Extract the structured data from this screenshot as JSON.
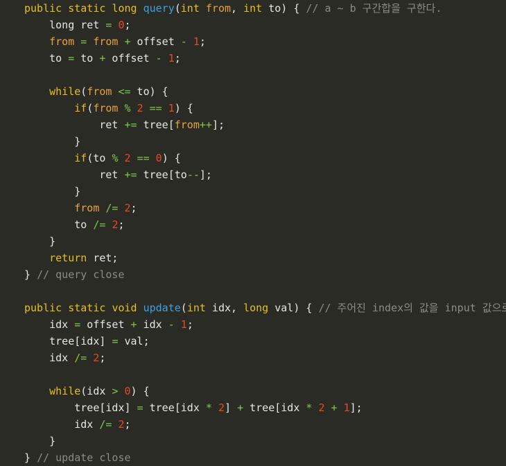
{
  "editor": {
    "name": "java-code-viewer",
    "language": "Java",
    "background_color": "#2b2b26",
    "font_size_px": 15,
    "line_height_px": 24,
    "colors": {
      "background": "#2b2b26",
      "default_text": "#e6e6e6",
      "keyword": "#e5c01e",
      "method": "#3fa2e0",
      "field": "#e8a33d",
      "number": "#e8491f",
      "operator": "#7ec94a",
      "comment": "#8c8c86"
    }
  },
  "code": {
    "lines": [
      {
        "id": 1,
        "indent": 0,
        "tokens": [
          {
            "t": "kw",
            "v": "public"
          },
          {
            "t": "txt",
            "v": " "
          },
          {
            "t": "kw",
            "v": "static"
          },
          {
            "t": "txt",
            "v": " "
          },
          {
            "t": "kw",
            "v": "long"
          },
          {
            "t": "txt",
            "v": " "
          },
          {
            "t": "mth",
            "v": "query"
          },
          {
            "t": "txt",
            "v": "("
          },
          {
            "t": "kw",
            "v": "int"
          },
          {
            "t": "txt",
            "v": " "
          },
          {
            "t": "fld",
            "v": "from"
          },
          {
            "t": "txt",
            "v": ", "
          },
          {
            "t": "kw",
            "v": "int"
          },
          {
            "t": "txt",
            "v": " to) { "
          },
          {
            "t": "cmt",
            "v": "// a ~ b 구간합을 구한다."
          }
        ]
      },
      {
        "id": 2,
        "indent": 1,
        "tokens": [
          {
            "t": "txt",
            "v": "long ret "
          },
          {
            "t": "op",
            "v": "="
          },
          {
            "t": "txt",
            "v": " "
          },
          {
            "t": "num",
            "v": "0"
          },
          {
            "t": "txt",
            "v": ";"
          }
        ]
      },
      {
        "id": 3,
        "indent": 1,
        "tokens": [
          {
            "t": "fld",
            "v": "from"
          },
          {
            "t": "txt",
            "v": " "
          },
          {
            "t": "op",
            "v": "="
          },
          {
            "t": "txt",
            "v": " "
          },
          {
            "t": "fld",
            "v": "from"
          },
          {
            "t": "txt",
            "v": " "
          },
          {
            "t": "op",
            "v": "+"
          },
          {
            "t": "txt",
            "v": " offset "
          },
          {
            "t": "op",
            "v": "-"
          },
          {
            "t": "txt",
            "v": " "
          },
          {
            "t": "num",
            "v": "1"
          },
          {
            "t": "txt",
            "v": ";"
          }
        ]
      },
      {
        "id": 4,
        "indent": 1,
        "tokens": [
          {
            "t": "txt",
            "v": "to "
          },
          {
            "t": "op",
            "v": "="
          },
          {
            "t": "txt",
            "v": " to "
          },
          {
            "t": "op",
            "v": "+"
          },
          {
            "t": "txt",
            "v": " offset "
          },
          {
            "t": "op",
            "v": "-"
          },
          {
            "t": "txt",
            "v": " "
          },
          {
            "t": "num",
            "v": "1"
          },
          {
            "t": "txt",
            "v": ";"
          }
        ]
      },
      {
        "id": 5,
        "indent": 0,
        "tokens": []
      },
      {
        "id": 6,
        "indent": 1,
        "tokens": [
          {
            "t": "kw",
            "v": "while"
          },
          {
            "t": "txt",
            "v": "("
          },
          {
            "t": "fld",
            "v": "from"
          },
          {
            "t": "txt",
            "v": " "
          },
          {
            "t": "op",
            "v": "<="
          },
          {
            "t": "txt",
            "v": " to) {"
          }
        ]
      },
      {
        "id": 7,
        "indent": 2,
        "tokens": [
          {
            "t": "kw",
            "v": "if"
          },
          {
            "t": "txt",
            "v": "("
          },
          {
            "t": "fld",
            "v": "from"
          },
          {
            "t": "txt",
            "v": " "
          },
          {
            "t": "op",
            "v": "%"
          },
          {
            "t": "txt",
            "v": " "
          },
          {
            "t": "num",
            "v": "2"
          },
          {
            "t": "txt",
            "v": " "
          },
          {
            "t": "op",
            "v": "=="
          },
          {
            "t": "txt",
            "v": " "
          },
          {
            "t": "num",
            "v": "1"
          },
          {
            "t": "txt",
            "v": ") {"
          }
        ]
      },
      {
        "id": 8,
        "indent": 3,
        "tokens": [
          {
            "t": "txt",
            "v": "ret "
          },
          {
            "t": "op",
            "v": "+="
          },
          {
            "t": "txt",
            "v": " tree["
          },
          {
            "t": "fld",
            "v": "from"
          },
          {
            "t": "op",
            "v": "++"
          },
          {
            "t": "txt",
            "v": "];"
          }
        ]
      },
      {
        "id": 9,
        "indent": 2,
        "tokens": [
          {
            "t": "txt",
            "v": "}"
          }
        ]
      },
      {
        "id": 10,
        "indent": 2,
        "tokens": [
          {
            "t": "kw",
            "v": "if"
          },
          {
            "t": "txt",
            "v": "(to "
          },
          {
            "t": "op",
            "v": "%"
          },
          {
            "t": "txt",
            "v": " "
          },
          {
            "t": "num",
            "v": "2"
          },
          {
            "t": "txt",
            "v": " "
          },
          {
            "t": "op",
            "v": "=="
          },
          {
            "t": "txt",
            "v": " "
          },
          {
            "t": "num",
            "v": "0"
          },
          {
            "t": "txt",
            "v": ") {"
          }
        ]
      },
      {
        "id": 11,
        "indent": 3,
        "tokens": [
          {
            "t": "txt",
            "v": "ret "
          },
          {
            "t": "op",
            "v": "+="
          },
          {
            "t": "txt",
            "v": " tree[to"
          },
          {
            "t": "op",
            "v": "--"
          },
          {
            "t": "txt",
            "v": "];"
          }
        ]
      },
      {
        "id": 12,
        "indent": 2,
        "tokens": [
          {
            "t": "txt",
            "v": "}"
          }
        ]
      },
      {
        "id": 13,
        "indent": 2,
        "tokens": [
          {
            "t": "fld",
            "v": "from"
          },
          {
            "t": "txt",
            "v": " "
          },
          {
            "t": "op",
            "v": "/="
          },
          {
            "t": "txt",
            "v": " "
          },
          {
            "t": "num",
            "v": "2"
          },
          {
            "t": "txt",
            "v": ";"
          }
        ]
      },
      {
        "id": 14,
        "indent": 2,
        "tokens": [
          {
            "t": "txt",
            "v": "to "
          },
          {
            "t": "op",
            "v": "/="
          },
          {
            "t": "txt",
            "v": " "
          },
          {
            "t": "num",
            "v": "2"
          },
          {
            "t": "txt",
            "v": ";"
          }
        ]
      },
      {
        "id": 15,
        "indent": 1,
        "tokens": [
          {
            "t": "txt",
            "v": "}"
          }
        ]
      },
      {
        "id": 16,
        "indent": 1,
        "tokens": [
          {
            "t": "kw",
            "v": "return"
          },
          {
            "t": "txt",
            "v": " ret;"
          }
        ]
      },
      {
        "id": 17,
        "indent": 0,
        "tokens": [
          {
            "t": "txt",
            "v": "} "
          },
          {
            "t": "cmt",
            "v": "// query close"
          }
        ]
      },
      {
        "id": 18,
        "indent": 0,
        "tokens": []
      },
      {
        "id": 19,
        "indent": 0,
        "tokens": [
          {
            "t": "kw",
            "v": "public"
          },
          {
            "t": "txt",
            "v": " "
          },
          {
            "t": "kw",
            "v": "static"
          },
          {
            "t": "txt",
            "v": " "
          },
          {
            "t": "kw",
            "v": "void"
          },
          {
            "t": "txt",
            "v": " "
          },
          {
            "t": "mth",
            "v": "update"
          },
          {
            "t": "txt",
            "v": "("
          },
          {
            "t": "kw",
            "v": "int"
          },
          {
            "t": "txt",
            "v": " idx, "
          },
          {
            "t": "kw",
            "v": "long"
          },
          {
            "t": "txt",
            "v": " val) { "
          },
          {
            "t": "cmt",
            "v": "// 주어진 index의 값을 input 값으로 변경한다."
          }
        ]
      },
      {
        "id": 20,
        "indent": 1,
        "tokens": [
          {
            "t": "txt",
            "v": "idx "
          },
          {
            "t": "op",
            "v": "="
          },
          {
            "t": "txt",
            "v": " offset "
          },
          {
            "t": "op",
            "v": "+"
          },
          {
            "t": "txt",
            "v": " idx "
          },
          {
            "t": "op",
            "v": "-"
          },
          {
            "t": "txt",
            "v": " "
          },
          {
            "t": "num",
            "v": "1"
          },
          {
            "t": "txt",
            "v": ";"
          }
        ]
      },
      {
        "id": 21,
        "indent": 1,
        "tokens": [
          {
            "t": "txt",
            "v": "tree[idx] "
          },
          {
            "t": "op",
            "v": "="
          },
          {
            "t": "txt",
            "v": " val;"
          }
        ]
      },
      {
        "id": 22,
        "indent": 1,
        "tokens": [
          {
            "t": "txt",
            "v": "idx "
          },
          {
            "t": "op",
            "v": "/="
          },
          {
            "t": "txt",
            "v": " "
          },
          {
            "t": "num",
            "v": "2"
          },
          {
            "t": "txt",
            "v": ";"
          }
        ]
      },
      {
        "id": 23,
        "indent": 0,
        "tokens": []
      },
      {
        "id": 24,
        "indent": 1,
        "tokens": [
          {
            "t": "kw",
            "v": "while"
          },
          {
            "t": "txt",
            "v": "(idx "
          },
          {
            "t": "op",
            "v": ">"
          },
          {
            "t": "txt",
            "v": " "
          },
          {
            "t": "num",
            "v": "0"
          },
          {
            "t": "txt",
            "v": ") {"
          }
        ]
      },
      {
        "id": 25,
        "indent": 2,
        "tokens": [
          {
            "t": "txt",
            "v": "tree[idx] "
          },
          {
            "t": "op",
            "v": "="
          },
          {
            "t": "txt",
            "v": " tree[idx "
          },
          {
            "t": "op",
            "v": "*"
          },
          {
            "t": "txt",
            "v": " "
          },
          {
            "t": "num",
            "v": "2"
          },
          {
            "t": "txt",
            "v": "] "
          },
          {
            "t": "op",
            "v": "+"
          },
          {
            "t": "txt",
            "v": " tree[idx "
          },
          {
            "t": "op",
            "v": "*"
          },
          {
            "t": "txt",
            "v": " "
          },
          {
            "t": "num",
            "v": "2"
          },
          {
            "t": "txt",
            "v": " "
          },
          {
            "t": "op",
            "v": "+"
          },
          {
            "t": "txt",
            "v": " "
          },
          {
            "t": "num",
            "v": "1"
          },
          {
            "t": "txt",
            "v": "];"
          }
        ]
      },
      {
        "id": 26,
        "indent": 2,
        "tokens": [
          {
            "t": "txt",
            "v": "idx "
          },
          {
            "t": "op",
            "v": "/="
          },
          {
            "t": "txt",
            "v": " "
          },
          {
            "t": "num",
            "v": "2"
          },
          {
            "t": "txt",
            "v": ";"
          }
        ]
      },
      {
        "id": 27,
        "indent": 1,
        "tokens": [
          {
            "t": "txt",
            "v": "}"
          }
        ]
      },
      {
        "id": 28,
        "indent": 0,
        "tokens": [
          {
            "t": "txt",
            "v": "} "
          },
          {
            "t": "cmt",
            "v": "// update close"
          }
        ]
      }
    ]
  }
}
